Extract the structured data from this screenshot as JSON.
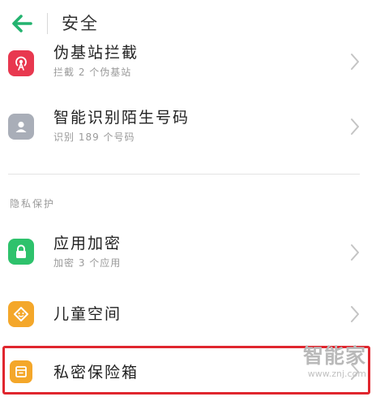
{
  "header": {
    "title": "安全"
  },
  "rows": [
    {
      "title": "伪基站拦截",
      "subtitle": "拦截 2 个伪基站",
      "icon_color": "#e8384f"
    },
    {
      "title": "智能识别陌生号码",
      "subtitle": "识别 189 个号码",
      "icon_color": "#a9aeb8"
    }
  ],
  "privacy_section": {
    "label": "隐私保护",
    "items": [
      {
        "title": "应用加密",
        "subtitle": "加密 3 个应用",
        "icon_color": "#2ec26c"
      },
      {
        "title": "儿童空间",
        "icon_color": "#f4a72a"
      },
      {
        "title": "私密保险箱",
        "icon_color": "#f4a72a"
      }
    ]
  },
  "watermark": {
    "main": "智能家",
    "url": "www.znj.com"
  },
  "colors": {
    "back_arrow": "#23b36f",
    "highlight": "#e0262e"
  }
}
